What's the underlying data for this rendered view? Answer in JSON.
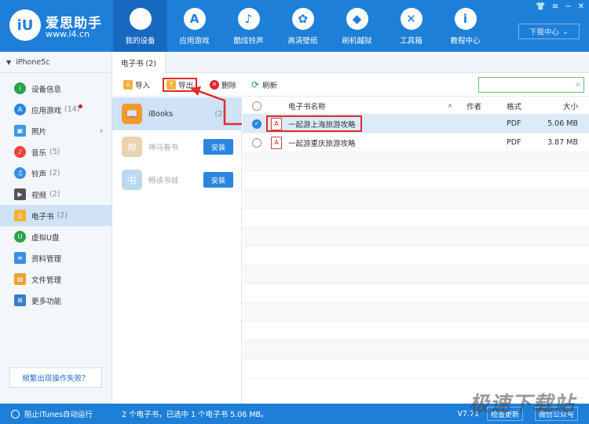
{
  "brand": {
    "logo": "iU",
    "name": "爱思助手",
    "url": "www.i4.cn"
  },
  "nav": [
    {
      "label": "我的设备",
      "icon": "apple-icon",
      "glyph": "",
      "active": true
    },
    {
      "label": "应用游戏",
      "icon": "app-store-icon",
      "glyph": "A"
    },
    {
      "label": "酷炫铃声",
      "icon": "bell-icon",
      "glyph": "♪"
    },
    {
      "label": "高清壁纸",
      "icon": "flower-icon",
      "glyph": "✿"
    },
    {
      "label": "刷机越狱",
      "icon": "dropbox-icon",
      "glyph": "◆"
    },
    {
      "label": "工具箱",
      "icon": "tools-icon",
      "glyph": "✕"
    },
    {
      "label": "教程中心",
      "icon": "info-icon",
      "glyph": "i"
    }
  ],
  "window": {
    "download_center": "下载中心"
  },
  "device": {
    "name": "iPhone5c"
  },
  "sidebar": [
    {
      "label": "设备信息",
      "count": "",
      "color": "#2aa24a",
      "glyph": "i"
    },
    {
      "label": "应用游戏",
      "count": "(14)",
      "color": "#2a86de",
      "glyph": "A",
      "dot": true
    },
    {
      "label": "照片",
      "count": "",
      "color": "#3a9be6",
      "glyph": "▣",
      "chev": true
    },
    {
      "label": "音乐",
      "count": "(5)",
      "color": "#e9453a",
      "glyph": "♪"
    },
    {
      "label": "铃声",
      "count": "(2)",
      "color": "#3a8ee0",
      "glyph": "🔔"
    },
    {
      "label": "视频",
      "count": "(2)",
      "color": "#555",
      "glyph": "▶"
    },
    {
      "label": "电子书",
      "count": "(2)",
      "color": "#f0b43a",
      "glyph": "▯",
      "active": true
    },
    {
      "label": "虚拟U盘",
      "count": "",
      "color": "#2aa24a",
      "glyph": "U"
    },
    {
      "label": "资料管理",
      "count": "",
      "color": "#3a8ee0",
      "glyph": "≡"
    },
    {
      "label": "文件管理",
      "count": "",
      "color": "#f0a030",
      "glyph": "▤"
    },
    {
      "label": "更多功能",
      "count": "",
      "color": "#3a7cc8",
      "glyph": "⊞"
    }
  ],
  "feedback": "频繁出现操作失败？",
  "tab": "电子书 (2)",
  "toolbar": {
    "import": "导入",
    "export": "导出",
    "delete": "删除",
    "refresh": "刷新",
    "search_placeholder": ""
  },
  "apps": [
    {
      "name": "iBooks",
      "count": "(2)",
      "color": "#f29a2e",
      "active": true
    },
    {
      "name": "神马看书",
      "install": "安装",
      "color": "#e8d2b0",
      "dim": true
    },
    {
      "name": "畅读书城",
      "install": "安装",
      "color": "#bcd9f2",
      "dim": true
    }
  ],
  "table": {
    "headers": {
      "name": "电子书名称",
      "author": "作者",
      "format": "格式",
      "size": "大小"
    },
    "rows": [
      {
        "name": "一起游上海旅游攻略",
        "author": "",
        "format": "PDF",
        "size": "5.06 MB",
        "checked": true
      },
      {
        "name": "一起游重庆旅游攻略",
        "author": "",
        "format": "PDF",
        "size": "3.87 MB",
        "checked": false
      }
    ]
  },
  "status": {
    "itunes": "阻止iTunes自动运行",
    "info": "2 个电子书，已选中 1 个电子书 5.06 MB。",
    "version": "V7.71",
    "check_update": "检查更新",
    "wechat": "微信公众号"
  },
  "watermark": "极速下载站"
}
